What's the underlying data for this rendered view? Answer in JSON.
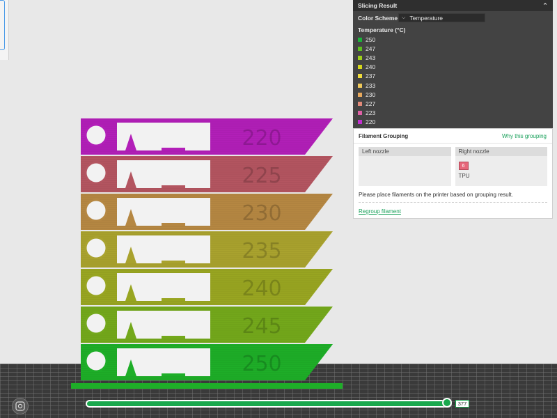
{
  "panel": {
    "title": "Slicing Result",
    "color_scheme_label": "Color Scheme",
    "color_scheme_value": "Temperature",
    "legend_title": "Temperature (°C)",
    "legend": [
      {
        "label": "250",
        "color": "#1bb33a"
      },
      {
        "label": "247",
        "color": "#5cbf1f"
      },
      {
        "label": "243",
        "color": "#9ed01a"
      },
      {
        "label": "240",
        "color": "#d6d81a"
      },
      {
        "label": "237",
        "color": "#f0dc3c"
      },
      {
        "label": "233",
        "color": "#f0c95a"
      },
      {
        "label": "230",
        "color": "#e8a95c"
      },
      {
        "label": "227",
        "color": "#e38a79"
      },
      {
        "label": "223",
        "color": "#e060a6"
      },
      {
        "label": "220",
        "color": "#c32fd0"
      }
    ]
  },
  "grouping": {
    "title": "Filament Grouping",
    "why_link": "Why this grouping",
    "left_nozzle": "Left nozzle",
    "right_nozzle": "Right nozzle",
    "filament_number": "6",
    "filament_name": "TPU",
    "notice": "Please place filaments on the printer based on grouping result.",
    "regroup_link": "Regroup filament"
  },
  "model": {
    "tiers": [
      {
        "label": "220",
        "color": "#b21fb8"
      },
      {
        "label": "225",
        "color": "#b35560"
      },
      {
        "label": "230",
        "color": "#b58742"
      },
      {
        "label": "235",
        "color": "#a9a22e"
      },
      {
        "label": "240",
        "color": "#98a521"
      },
      {
        "label": "245",
        "color": "#73a81b"
      },
      {
        "label": "250",
        "color": "#1eae28"
      }
    ]
  },
  "slider": {
    "value": 377,
    "fraction": 1.0,
    "label": "377"
  },
  "icons": {
    "collapse": "chevron-up-double-icon",
    "select": "chevron-down-icon",
    "camera": "camera-reset-icon"
  }
}
